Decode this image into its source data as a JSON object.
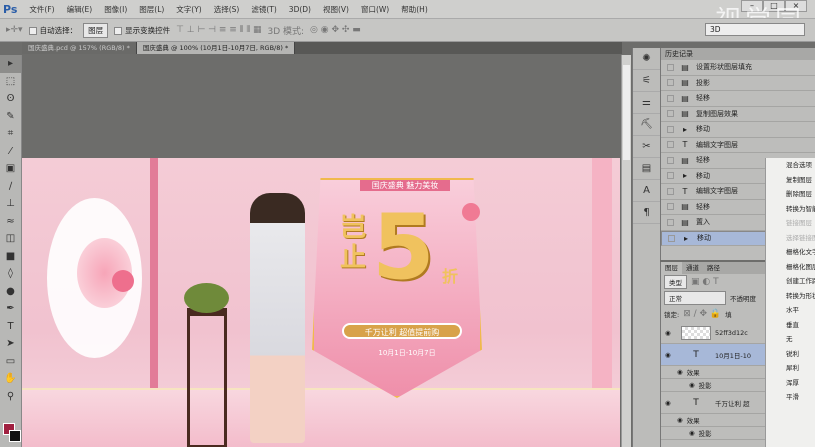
{
  "app": {
    "logo": "Ps",
    "watermark": "视觉同"
  },
  "menu": [
    "文件(F)",
    "编辑(E)",
    "图像(I)",
    "图层(L)",
    "文字(Y)",
    "选择(S)",
    "滤镜(T)",
    "3D(D)",
    "视图(V)",
    "窗口(W)",
    "帮助(H)"
  ],
  "options": {
    "auto_select": "自动选择：",
    "auto_select_target": "图层",
    "show_transform": "显示变换控件",
    "mode_3d": "3D 模式:",
    "workspace": "3D"
  },
  "tabs": [
    {
      "label": "国庆盛典.pcd @ 157% (RGB/8) *",
      "active": false
    },
    {
      "label": "国庆盛典 @ 100% (10月1日-10月7日, RGB/8) *",
      "active": true
    }
  ],
  "banner": {
    "top_text": "国庆盛典 魅力美妆",
    "headline_chars": "岂止",
    "big_number": "5",
    "discount": "折",
    "pill": "千万让利 超值提前购",
    "dates": "10月1日-10月7日"
  },
  "history": {
    "title": "历史记录",
    "items": [
      {
        "icon": "doc",
        "label": "设置形状图层填充"
      },
      {
        "icon": "doc",
        "label": "投影"
      },
      {
        "icon": "doc",
        "label": "轻移"
      },
      {
        "icon": "doc",
        "label": "复制图层效果"
      },
      {
        "icon": "move",
        "label": "移动"
      },
      {
        "icon": "T",
        "label": "编辑文字图层"
      },
      {
        "icon": "doc",
        "label": "轻移"
      },
      {
        "icon": "move",
        "label": "移动"
      },
      {
        "icon": "T",
        "label": "编辑文字图层"
      },
      {
        "icon": "doc",
        "label": "轻移"
      },
      {
        "icon": "doc",
        "label": "置入"
      },
      {
        "icon": "move",
        "label": "移动",
        "selected": true
      }
    ]
  },
  "layers": {
    "tabs": [
      "图层",
      "通道",
      "路径"
    ],
    "filter": "类型",
    "blend": "正常",
    "opacity_label": "不透明度",
    "lock_label": "锁定:",
    "fill_label": "填",
    "rows": [
      {
        "name": "52ff3d12c"
      },
      {
        "name": "10月1日-10"
      },
      {
        "name": "效果"
      },
      {
        "name": "投影"
      },
      {
        "name": "千万让利 超"
      },
      {
        "name": "效果"
      },
      {
        "name": "投影"
      }
    ]
  },
  "context_menu": [
    {
      "label": "混合选项"
    },
    {
      "label": "复制图层"
    },
    {
      "label": "删除图层"
    },
    {
      "label": "转换为智能对象"
    },
    {
      "label": "链接图层",
      "disabled": true
    },
    {
      "label": "选择链接图层",
      "disabled": true
    },
    {
      "label": "栅格化文字"
    },
    {
      "label": "栅格化图层样式"
    },
    {
      "label": "创建工作路径"
    },
    {
      "label": "转换为形状"
    },
    {
      "label": "水平"
    },
    {
      "label": "垂直"
    },
    {
      "label": "无"
    },
    {
      "label": "锐利"
    },
    {
      "label": "犀利"
    },
    {
      "label": "浑厚"
    },
    {
      "label": "平滑"
    }
  ],
  "colors": {
    "foreground": "#a02040",
    "background": "#111111",
    "accent": "#a7b8d8"
  }
}
